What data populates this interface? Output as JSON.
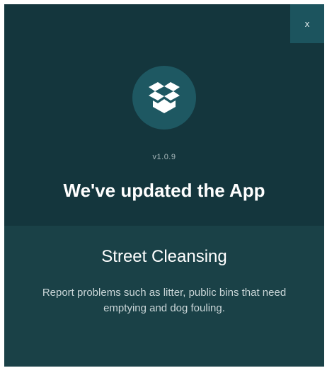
{
  "modal": {
    "close_label": "x",
    "icon": "dropbox-box-icon",
    "version": "v1.0.9",
    "headline": "We've updated the App"
  },
  "content": {
    "title": "Street Cleansing",
    "description": "Report problems such as litter, public bins that need emptying and dog fouling."
  },
  "colors": {
    "header_bg": "#14363d",
    "body_bg": "#1a4147",
    "accent": "#1e5862",
    "close_bg": "#1c545e"
  }
}
